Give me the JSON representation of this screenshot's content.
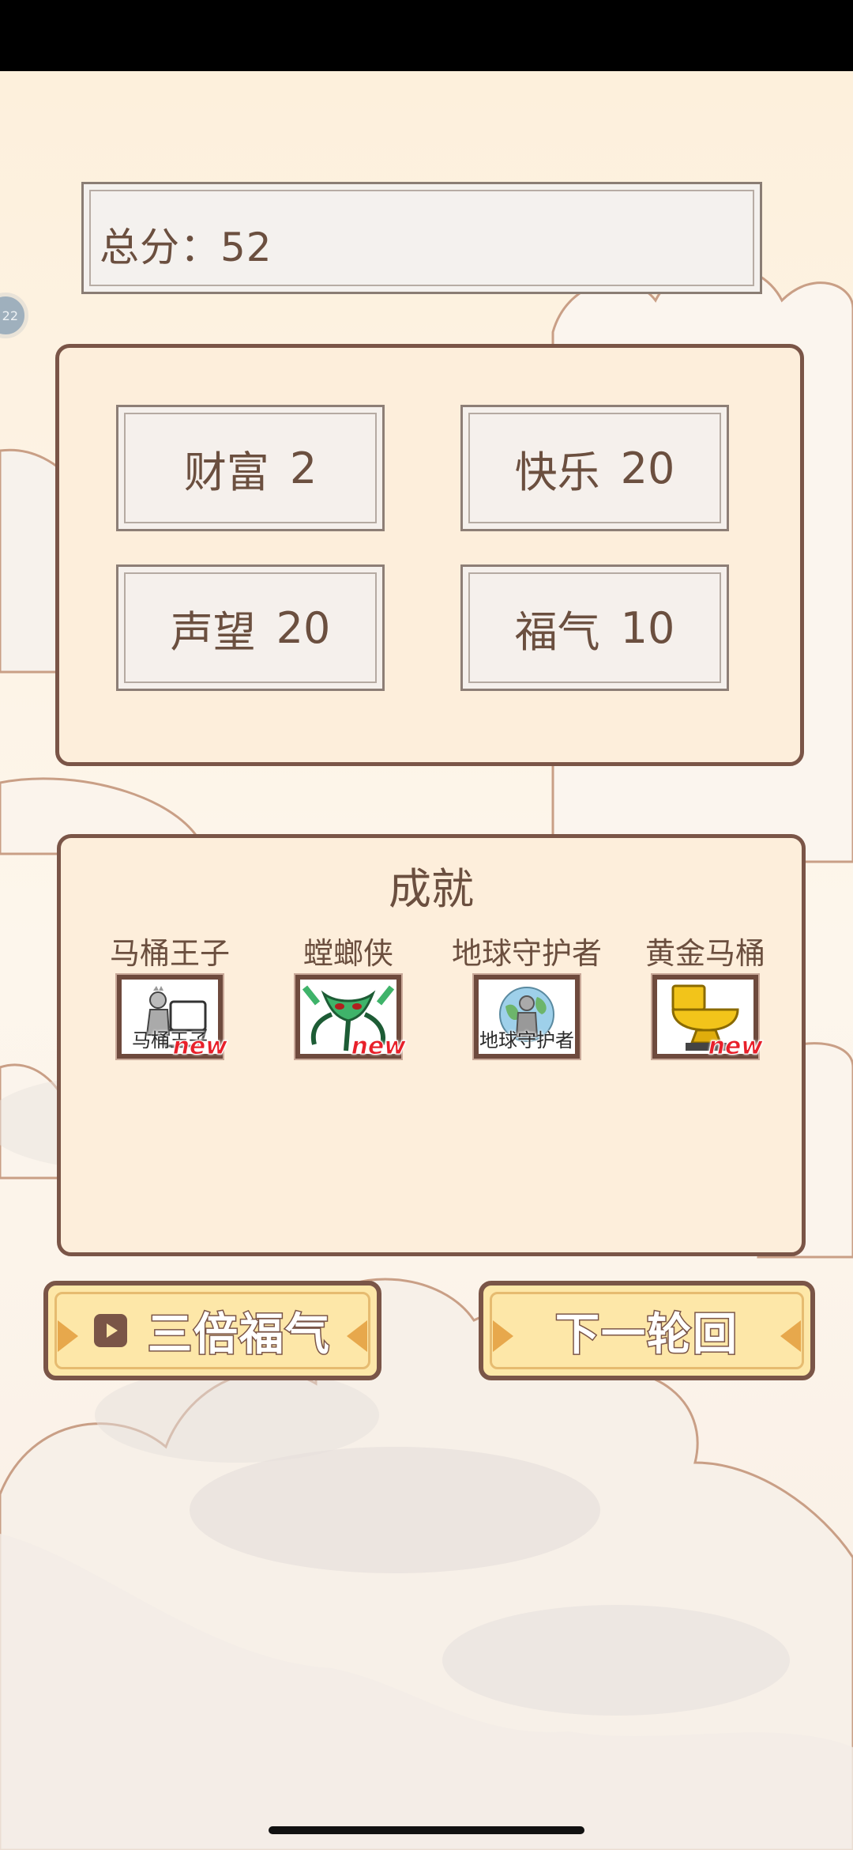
{
  "score": {
    "label": "总分：",
    "value": "52"
  },
  "stats": [
    {
      "label": "财富",
      "value": "2"
    },
    {
      "label": "快乐",
      "value": "20"
    },
    {
      "label": "声望",
      "value": "20"
    },
    {
      "label": "福气",
      "value": "10"
    }
  ],
  "achievements": {
    "title": "成就",
    "items": [
      {
        "name": "马桶王子",
        "thumb_caption": "马桶王子",
        "is_new": true,
        "new_label": "new",
        "icon": "toilet-prince-icon"
      },
      {
        "name": "螳螂侠",
        "thumb_caption": "",
        "is_new": true,
        "new_label": "new",
        "icon": "mantis-icon"
      },
      {
        "name": "地球守护者",
        "thumb_caption": "地球守护者",
        "is_new": false,
        "new_label": "",
        "icon": "earth-guardian-icon"
      },
      {
        "name": "黄金马桶",
        "thumb_caption": "",
        "is_new": true,
        "new_label": "new",
        "icon": "golden-toilet-icon"
      }
    ]
  },
  "buttons": {
    "triple": {
      "label": "三倍福气",
      "icon": "video-icon"
    },
    "next": {
      "label": "下一轮回"
    }
  },
  "floating_bubble": "22",
  "colors": {
    "panel_border": "#7a5547",
    "panel_bg": "#fdeedb",
    "text": "#6b4f3f",
    "button_bg": "#fde7a8",
    "new_red": "#e8202a"
  }
}
